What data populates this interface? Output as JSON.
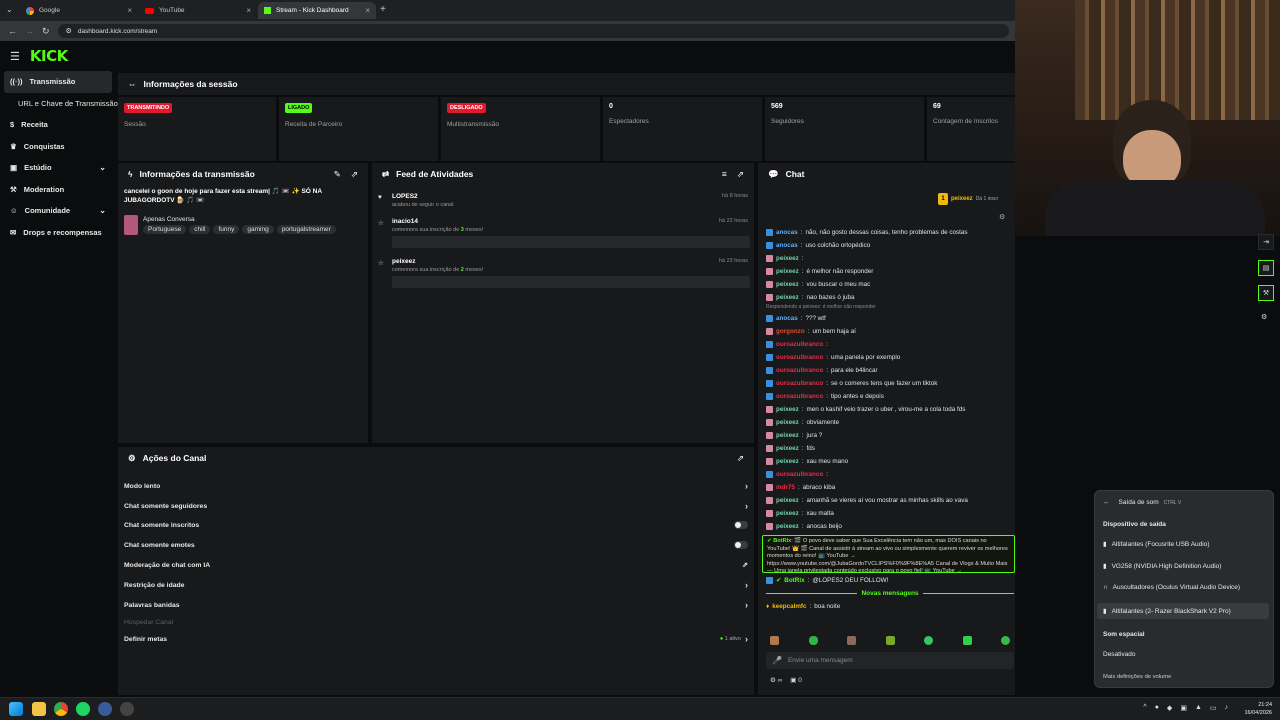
{
  "browser": {
    "tabs": [
      {
        "title": "Google"
      },
      {
        "title": "YouTube"
      },
      {
        "title": "Stream - Kick Dashboard"
      }
    ],
    "url": "dashboard.kick.com/stream"
  },
  "brand": {
    "logo_text": "KICK"
  },
  "sidebar": {
    "items": [
      {
        "label": "Transmissão"
      },
      {
        "label": "URL e Chave de Transmissão"
      },
      {
        "label": "Receita"
      },
      {
        "label": "Conquistas"
      },
      {
        "label": "Estúdio"
      },
      {
        "label": "Moderation"
      },
      {
        "label": "Comunidade"
      },
      {
        "label": "Drops e recompensas"
      }
    ]
  },
  "session": {
    "title": "Informações da sessão",
    "stats": [
      {
        "badge": "TRANSMITINDO",
        "label": "Sessão"
      },
      {
        "badge": "LIGADO",
        "label": "Receita de Parceiro"
      },
      {
        "badge": "DESLIGADO",
        "label": "Multistransmissão"
      },
      {
        "value": "0",
        "label": "Espectadores"
      },
      {
        "value": "569",
        "label": "Seguidores"
      },
      {
        "value": "69",
        "label": "Contagem de Inscritos"
      }
    ]
  },
  "stream_info": {
    "title": "Informações da transmissão",
    "stream_title": "cancelei o goon de hoje para fazer esta stream| 🎵 📼 ✨ SÓ NA JUBAGORDOTV 🍺 🎵 📼",
    "category": "Apenas Conversa",
    "tags": [
      "Portuguese",
      "chill",
      "funny",
      "gaming",
      "portugalstreamer"
    ]
  },
  "feed": {
    "title": "Feed de Atividades",
    "items": [
      {
        "user": "LOPES2",
        "text": "acabou de seguir o canal",
        "time": "há 8 horas"
      },
      {
        "user": "inacio14",
        "text_pre": "comemora sua inscrição de ",
        "months": "3",
        "text_post": " meses!",
        "time": "há 22 horas"
      },
      {
        "user": "peixeez",
        "text_pre": "comemora sua inscrição de ",
        "months": "2",
        "text_post": " meses!",
        "time": "há 23 horas"
      }
    ]
  },
  "actions": {
    "title": "Ações do Canal",
    "items": [
      {
        "label": "Modo lento",
        "control": "chevron"
      },
      {
        "label": "Chat somente seguidores",
        "control": "chevron"
      },
      {
        "label": "Chat somente inscritos",
        "control": "toggle"
      },
      {
        "label": "Chat somente emotes",
        "control": "toggle"
      },
      {
        "label": "Moderação de chat com IA",
        "control": "link"
      },
      {
        "label": "Restrição de idade",
        "control": "chevron"
      },
      {
        "label": "Palavras banidas",
        "control": "chevron"
      }
    ],
    "hospedar_label": "Hospedar Canal",
    "metas_label": "Definir metas",
    "metas_status": "1 ativo"
  },
  "chat": {
    "title": "Chat",
    "top_user": "peixeez",
    "top_rank": "1",
    "top_sub": "Dá 1 inscr",
    "messages": [
      {
        "user": "anocas",
        "text": "não, não gosto dessas coisas, tenho problemas de costas",
        "color": "#5bb0ff",
        "badge": "b"
      },
      {
        "user": "anocas",
        "text": "uso colchão ortopédico",
        "color": "#5bb0ff",
        "badge": "b"
      },
      {
        "user": "peixeez",
        "text": "",
        "color": "#6fd3a8",
        "badge": "p"
      },
      {
        "user": "peixeez",
        "text": "é melhor não responder",
        "color": "#6fd3a8",
        "badge": "p"
      },
      {
        "user": "peixeez",
        "text": "vou buscar o meu mac",
        "color": "#6fd3a8",
        "badge": "p"
      },
      {
        "user": "peixeez",
        "text": "nao bazes ó juba",
        "color": "#6fd3a8",
        "badge": "p"
      },
      {
        "user": "anocas",
        "text": "??? wtf",
        "color": "#5bb0ff",
        "badge": "b",
        "reply": "Respondendo a peixeez: é melhor não responder"
      },
      {
        "user": "gorgonzo",
        "text": "um bem haja aí",
        "color": "#e0492f",
        "badge": "p"
      },
      {
        "user": "ouroazulbranco",
        "text": "",
        "color": "#e0304a",
        "badge": "b"
      },
      {
        "user": "ouroazulbranco",
        "text": "uma panela por exemplo",
        "color": "#e0304a",
        "badge": "b"
      },
      {
        "user": "ouroazulbranco",
        "text": "para ele b4lincar",
        "color": "#e0304a",
        "badge": "b"
      },
      {
        "user": "ouroazulbranco",
        "text": "se o comeres tens que fazer um tiktok",
        "color": "#e0304a",
        "badge": "b"
      },
      {
        "user": "ouroazulbranco",
        "text": "tipo antes e depois",
        "color": "#e0304a",
        "badge": "b"
      },
      {
        "user": "peixeez",
        "text": "men o kashif veio trazer o uber , virou-me a cola toda fds",
        "color": "#6fd3a8",
        "badge": "p"
      },
      {
        "user": "peixeez",
        "text": "obviamente",
        "color": "#6fd3a8",
        "badge": "p"
      },
      {
        "user": "peixeez",
        "text": "jura ?",
        "color": "#6fd3a8",
        "badge": "p"
      },
      {
        "user": "peixeez",
        "text": "fds",
        "color": "#6fd3a8",
        "badge": "p"
      },
      {
        "user": "peixeez",
        "text": "xau meu mano",
        "color": "#6fd3a8",
        "badge": "p"
      },
      {
        "user": "ouroazulbranco",
        "text": "",
        "color": "#e0304a",
        "badge": "b"
      },
      {
        "user": "mdr75",
        "text": "abraco kiba",
        "color": "#e0304a",
        "badge": "p"
      },
      {
        "user": "peixeez",
        "text": "amanhã se vieres aí vou mostrar as minhas skills ao vava",
        "color": "#6fd3a8",
        "badge": "p"
      },
      {
        "user": "peixeez",
        "text": "xau malta",
        "color": "#6fd3a8",
        "badge": "p"
      },
      {
        "user": "peixeez",
        "text": "anocas beijo",
        "color": "#6fd3a8",
        "badge": "p"
      }
    ],
    "botrix_text": "🎬 O povo deve saber que Sua Excelência tem não um, mas DOIS canais no YouTube! 👑 🎬 Canal de assistir à stream ao vivo ou simplesmente querem reviver os melhores momentos do reino! 📺 YouTube → https://www.youtube.com/@JubaGordoTVCLIPS%F0%9F%8E%A5 Canal de Vlogs & Muito Mais — Uma janela privilegiada conteúdo exclusivo para o povo fiel! 📺 YouTube → https://www.youtube.com/@Jubagordotv",
    "botrix_user": "BotRix",
    "botrix_follow": "@LOPES2 DEU FOLLOW!",
    "new_messages": "Novas mensagens",
    "last_user": "keepcalmfc",
    "last_text": "boa noite",
    "input_placeholder": "Envie uma mensagem",
    "footer_count_a": "∞",
    "footer_count_b": "0"
  },
  "volume": {
    "header": "Saída de som",
    "shortcut": "CTRL V",
    "section": "Dispositivo de saída",
    "devices": [
      "Altifalantes (Focusrite USB Audio)",
      "VG258 (NVIDIA High Definition Audio)",
      "Auscultadores (Oculus Virtual Audio Device)",
      "Altifalantes (2- Razer BlackShark V2 Pro)"
    ],
    "spatial_label": "Som espacial",
    "spatial_value": "Desativado",
    "more": "Mais definições de volume"
  },
  "taskbar": {
    "time": "21:24",
    "date": "16/04/2026"
  },
  "colors": {
    "kick_green": "#53fc18",
    "panel": "#18191b",
    "bg": "#0b0c0d"
  }
}
